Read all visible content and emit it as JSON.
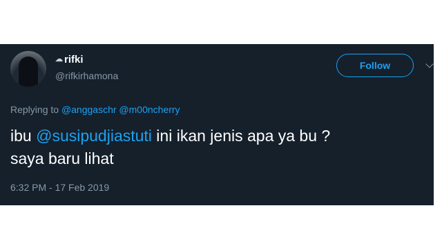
{
  "user": {
    "display_name": "rifki",
    "handle": "@rifkirhamona",
    "name_emoji_icon": "cloud-emoji-icon"
  },
  "follow_label": "Follow",
  "reply": {
    "prefix": "Replying to",
    "mentions": [
      "@anggaschr",
      "@m00ncherry"
    ]
  },
  "tweet": {
    "line1_before": "ibu ",
    "mention": "@susipudjiastuti",
    "line1_after": " ini ikan jenis apa ya bu ?",
    "line2": "saya baru lihat"
  },
  "timestamp": "6:32 PM - 17 Feb 2019",
  "colors": {
    "background": "#15202b",
    "accent": "#1da1f2",
    "muted": "#8899a6",
    "text": "#ffffff"
  }
}
